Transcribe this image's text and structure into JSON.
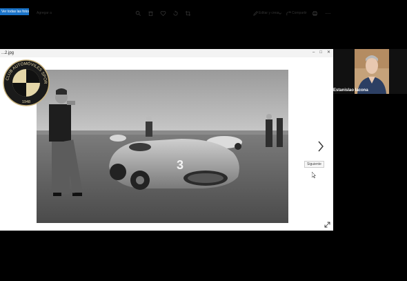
{
  "window": {
    "title": "...2.jpg",
    "controls": [
      "–",
      "□",
      "✕"
    ]
  },
  "toolbar": {
    "selected_label": "Ver todas las fotos",
    "back_label": "Agregar a",
    "edit_label": "Editar y crear",
    "share_label": "Compartir",
    "icons": [
      "zoom-icon",
      "rotate-icon",
      "heart-icon",
      "enhance-icon",
      "crop-icon",
      "more-icon"
    ]
  },
  "logo": {
    "top_text": "CLUB AUTOMÓVILES SPORT",
    "year": "1948"
  },
  "car": {
    "number": "3"
  },
  "nav": {
    "tooltip": "Siguiente"
  },
  "participant": {
    "name": "Estanislao Iacona"
  }
}
